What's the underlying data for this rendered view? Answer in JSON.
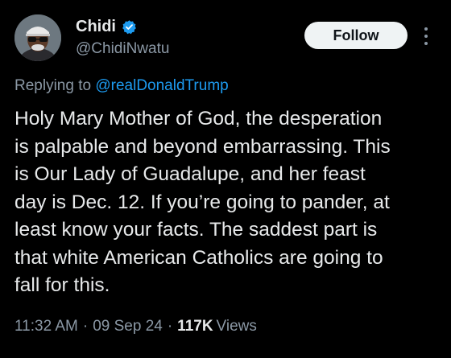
{
  "author": {
    "name": "Chidi",
    "handle": "@ChidiNwatu",
    "verified_color": "#1d9bf0"
  },
  "follow_label": "Follow",
  "replying_to": {
    "prefix": "Replying to",
    "mention": "@realDonaldTrump"
  },
  "tweet_lines": [
    "Holy Mary Mother of God, the desperation",
    "is palpable and beyond embarrassing. This",
    "is Our Lady of Guadalupe, and her feast",
    "day is Dec. 12. If you’re going to pander, at",
    "least know your facts. The saddest part is",
    "that white American Catholics are going to",
    "fall for this."
  ],
  "meta": {
    "time": "11:32 AM",
    "separator": "·",
    "date": "09 Sep 24",
    "views_count": "117K",
    "views_label": "Views"
  },
  "colors": {
    "background": "#000000",
    "text": "#e7e9ea",
    "secondary": "#8b98a5",
    "link": "#1d9bf0"
  }
}
